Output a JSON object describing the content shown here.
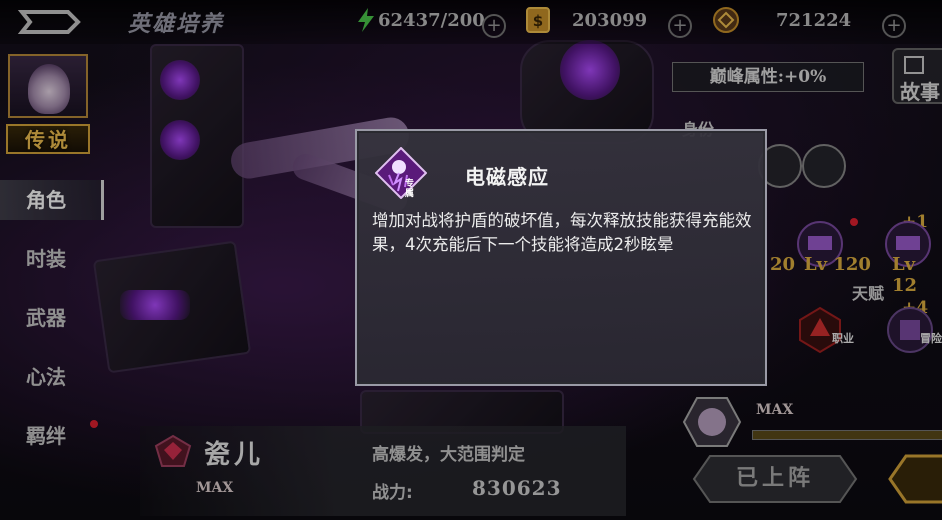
{
  "header": {
    "title": "英雄培养",
    "energy": "62437/200",
    "coins": "203099",
    "diamonds": "721224"
  },
  "sidebar": {
    "rarity": "传说",
    "items": [
      {
        "label": "角色",
        "active": true,
        "badge": false
      },
      {
        "label": "时装",
        "active": false,
        "badge": false
      },
      {
        "label": "武器",
        "active": false,
        "badge": false
      },
      {
        "label": "心法",
        "active": false,
        "badge": false
      },
      {
        "label": "羁绊",
        "active": false,
        "badge": true
      }
    ]
  },
  "right_panel": {
    "peak_attr": "巅峰属性:+0%",
    "story_label": "故事",
    "identity_label": "身份",
    "levels": [
      "20",
      "Lv 120",
      "Lv 12"
    ],
    "talent_label": "天赋",
    "plus_top": "+1",
    "plus_mid": "+4",
    "skill1_tag": "职业",
    "skill2_tag": "冒险",
    "max_label": "MAX",
    "deployed_label": "已上阵"
  },
  "hero": {
    "name": "瓷儿",
    "max_label": "MAX",
    "description": "高爆发，大范围判定",
    "power_label": "战力:",
    "power_value": "830623"
  },
  "tooltip": {
    "icon_tag": "专属",
    "title": "电磁感应",
    "description": "增加对战将护盾的破坏值，每次释放技能获得充能效果，4次充能后下一个技能将造成2秒眩晕"
  },
  "colors": {
    "accent_gold": "#e0b040",
    "accent_purple": "#b04cff",
    "badge_red": "#e02030"
  }
}
